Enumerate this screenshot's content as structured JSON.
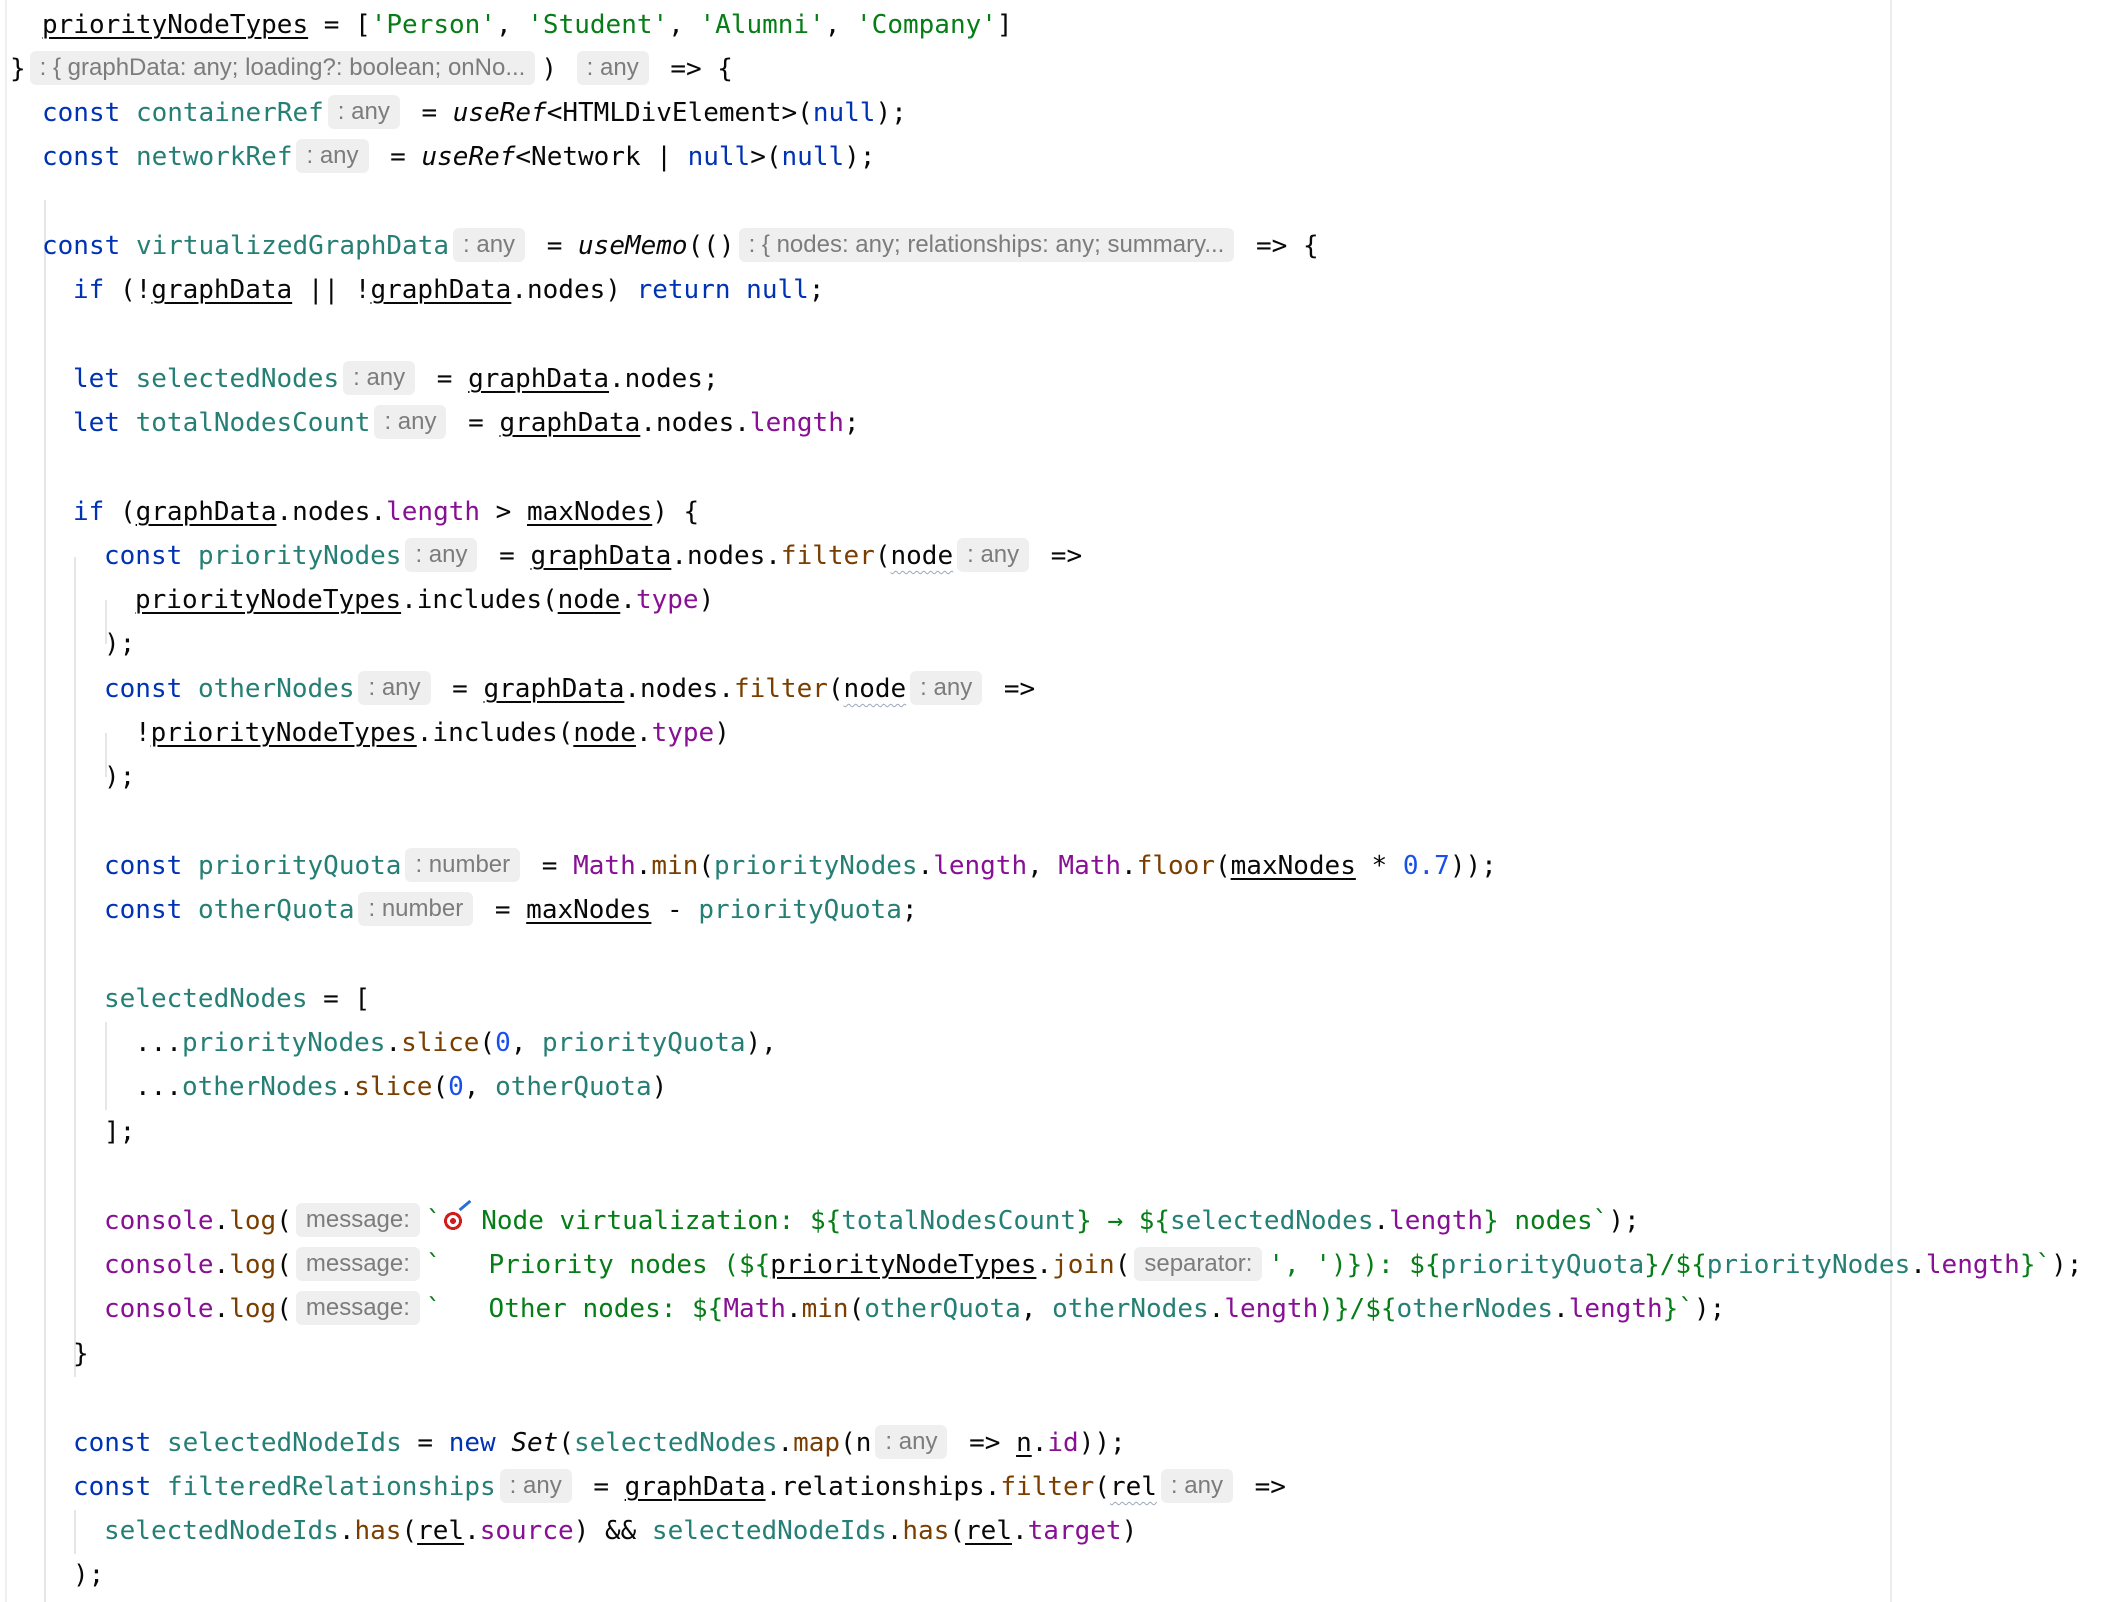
{
  "editor": {
    "language": "TypeScript",
    "hints": {
      "props_type": ": { graphData: any; loading?: boolean; onNo...",
      "any": ": any",
      "number": ": number",
      "memo_type": ": { nodes: any; relationships: any; summary...",
      "message": "message:",
      "separator": "separator:"
    },
    "code": {
      "l1_var": "priorityNodeTypes",
      "l1_rest": " = [",
      "l1_s1": "'Person'",
      "l1_s2": "'Student'",
      "l1_s3": "'Alumni'",
      "l1_s4": "'Company'",
      "l2_brace": "}",
      "l2_arrow": " => {",
      "const": "const",
      "let": "let",
      "if": "if",
      "return": "return",
      "null": "null",
      "new": "new",
      "containerRef": "containerRef",
      "useRef": "useRef",
      "l3_generic": "<HTMLDivElement>(",
      "l3_end": ");",
      "networkRef": "networkRef",
      "l4_generic": "<Network | ",
      "l4_mid": ">(",
      "virtualizedGraphData": "virtualizedGraphData",
      "useMemo": "useMemo",
      "l6_paren": "(()",
      "graphData": "graphData",
      "nodes": "nodes",
      "selectedNodes": "selectedNodes",
      "totalNodesCount": "totalNodesCount",
      "length": "length",
      "maxNodes": "maxNodes",
      "priorityNodes": "priorityNodes",
      "filter": "filter",
      "node": "node",
      "includes": "includes",
      "type": "type",
      "otherNodes": "otherNodes",
      "priorityQuota": "priorityQuota",
      "Math": "Math",
      "min": "min",
      "floor": "floor",
      "n07": "0.7",
      "otherQuota": "otherQuota",
      "slice": "slice",
      "zero": "0",
      "console": "console",
      "log": "log",
      "log1_a": "Node virtualization: ${",
      "log1_b": "} → ${",
      "log1_c": "} nodes`",
      "log2_a": "`   Priority nodes (${",
      "join": "join",
      "sep_str": "', '",
      "log2_b": ")}): ${",
      "log2_c": "}/${",
      "log2_d": "}`",
      "log3_a": "`   Other nodes: ${",
      "log3_b": ")}/${",
      "log3_c": "}`",
      "selectedNodeIds": "selectedNodeIds",
      "Set": "Set",
      "map": "map",
      "n": "n",
      "id": "id",
      "filteredRelationships": "filteredRelationships",
      "relationships": "relationships",
      "rel": "rel",
      "has": "has",
      "source": "source",
      "target": "target"
    }
  }
}
